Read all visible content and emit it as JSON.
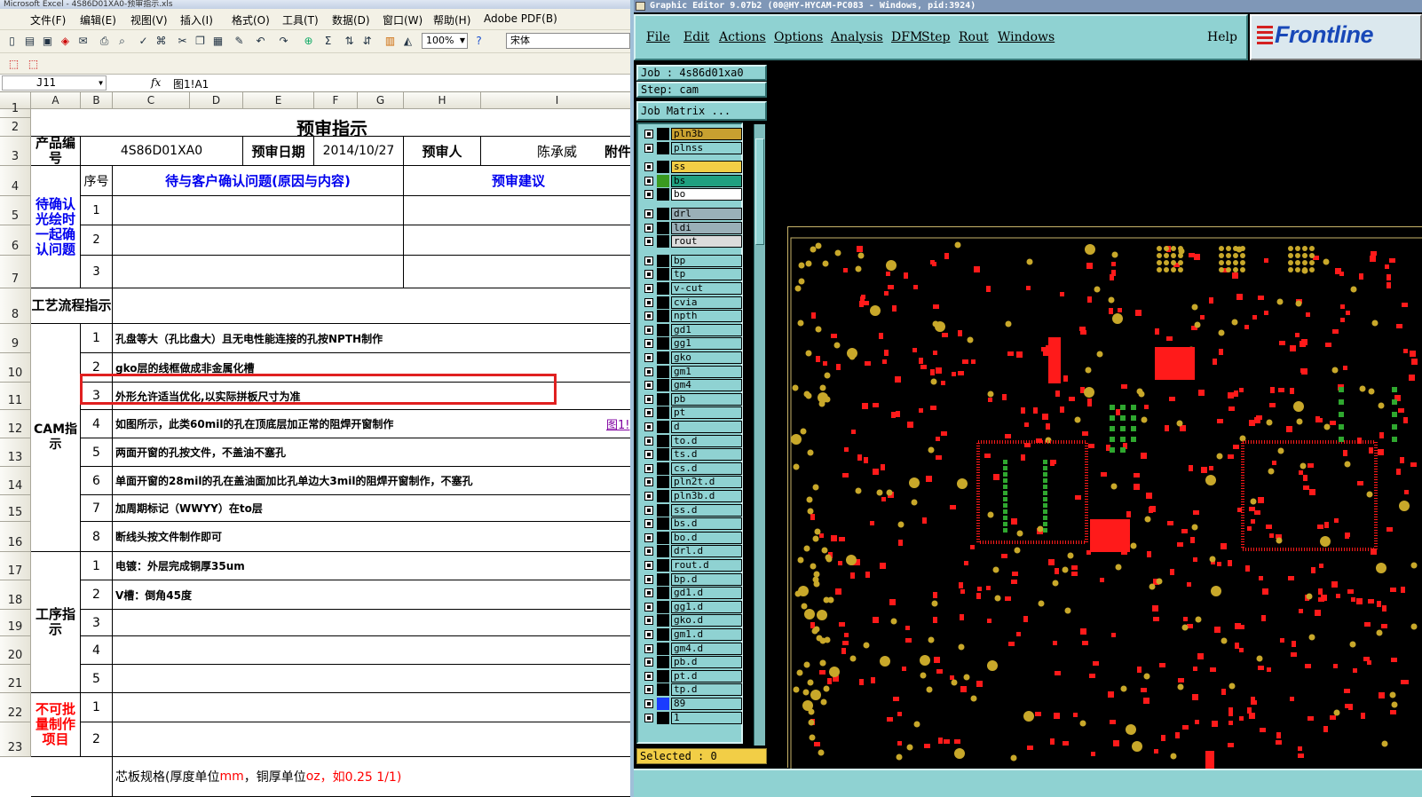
{
  "excel": {
    "title": "Microsoft Excel - 4S86D01XA0-预审指示.xls",
    "menu": [
      "文件(F)",
      "编辑(E)",
      "视图(V)",
      "插入(I)",
      "格式(O)",
      "工具(T)",
      "数据(D)",
      "窗口(W)",
      "帮助(H)",
      "Adobe PDF(B)"
    ],
    "zoom": "100%",
    "font_name": "宋体",
    "name_box": "J11",
    "fx": "fx",
    "formula": "图1!A1",
    "columns": [
      "A",
      "B",
      "C",
      "D",
      "E",
      "F",
      "G",
      "H",
      "I"
    ],
    "rows": [
      "1",
      "2",
      "3",
      "4",
      "5",
      "6",
      "7",
      "8",
      "9",
      "10",
      "11",
      "12",
      "13",
      "14",
      "15",
      "16",
      "17",
      "18",
      "19",
      "20",
      "21",
      "22",
      "23"
    ],
    "title_cell": "预审指示",
    "product_no_label": "产品编号",
    "product_no": "4S86D01XA0",
    "review_date_label": "预审日期",
    "review_date": "2014/10/27",
    "reviewer_label": "预审人",
    "reviewer": "陈承威",
    "attachment_label": "附件",
    "confirm_group": "待确认光绘时一起确认问题",
    "seq_label": "序号",
    "issue_header": "待与客户确认问题(原因与内容)",
    "suggest_header": "预审建议",
    "confirm_rows": [
      "1",
      "2",
      "3"
    ],
    "process_label": "工艺流程指示",
    "cam_label": "CAM指示",
    "cam_items": [
      {
        "no": "1",
        "text": "孔盘等大（孔比盘大）且无电性能连接的孔按NPTH制作"
      },
      {
        "no": "2",
        "text": "gko层的线框做成非金属化槽"
      },
      {
        "no": "3",
        "text": "外形允许适当优化,以实际拼板尺寸为准"
      },
      {
        "no": "4",
        "text": "如图所示，此类60mil的孔在顶底层加正常的阻焊开窗制作"
      },
      {
        "no": "5",
        "text": "两面开窗的孔按文件，不盖油不塞孔"
      },
      {
        "no": "6",
        "text": "单面开窗的28mil的孔在盖油面加比孔单边大3mil的阻焊开窗制作，不塞孔"
      },
      {
        "no": "7",
        "text": "加周期标记（WWYY）在to层"
      },
      {
        "no": "8",
        "text": "断线头按文件制作即可"
      }
    ],
    "link_text": "图1!",
    "process_step_label": "工序指示",
    "process_items": [
      {
        "no": "1",
        "text": "电镀：外层完成铜厚35um"
      },
      {
        "no": "2",
        "text": "V槽：倒角45度"
      },
      {
        "no": "3",
        "text": ""
      },
      {
        "no": "4",
        "text": ""
      },
      {
        "no": "5",
        "text": ""
      }
    ],
    "no_batch_label": "不可批量制作项目",
    "no_batch_rows": [
      "1",
      "2"
    ],
    "core_spec_a": "芯板规格(厚度单位",
    "core_spec_b": "mm",
    "core_spec_c": "，铜厚单位",
    "core_spec_d": "oz",
    "core_spec_e": "，如0.25 1/1)"
  },
  "frontline": {
    "title": "Graphic Editor 9.07b2 (00@HY-HYCAM-PC083 - Windows, pid:3924)",
    "menu": [
      "File",
      "Edit",
      "Actions",
      "Options",
      "Analysis",
      "DFM",
      "Step",
      "Rout",
      "Windows"
    ],
    "help": "Help",
    "logo": "Frontline",
    "job": "Job  : 4s86d01xa0",
    "step": "Step: cam",
    "job_matrix": "Job Matrix ...",
    "selected": "Selected : 0",
    "layers": [
      {
        "name": "pln3b",
        "fill": "#c8a030",
        "swatch": "#000"
      },
      {
        "name": "plnss",
        "fill": "#8fd2d2",
        "swatch": "#000"
      },
      {
        "name": "ss",
        "fill": "#f2ce46",
        "swatch": "#000"
      },
      {
        "name": "bs",
        "fill": "#20a080",
        "swatch": "#3a9a20"
      },
      {
        "name": "bo",
        "fill": "#ffffff",
        "swatch": "#000"
      },
      {
        "name": "drl",
        "fill": "#9ab0b8",
        "swatch": "#000"
      },
      {
        "name": "ldi",
        "fill": "#9ab0b8",
        "swatch": "#000"
      },
      {
        "name": "rout",
        "fill": "#dcdcdc",
        "swatch": "#000"
      },
      {
        "name": "bp",
        "fill": "#8fd2d2",
        "swatch": "#000"
      },
      {
        "name": "tp",
        "fill": "#8fd2d2",
        "swatch": "#000"
      },
      {
        "name": "v-cut",
        "fill": "#8fd2d2",
        "swatch": "#000"
      },
      {
        "name": "cvia",
        "fill": "#8fd2d2",
        "swatch": "#000"
      },
      {
        "name": "npth",
        "fill": "#8fd2d2",
        "swatch": "#000"
      },
      {
        "name": "gd1",
        "fill": "#8fd2d2",
        "swatch": "#000"
      },
      {
        "name": "gg1",
        "fill": "#8fd2d2",
        "swatch": "#000"
      },
      {
        "name": "gko",
        "fill": "#8fd2d2",
        "swatch": "#000"
      },
      {
        "name": "gm1",
        "fill": "#8fd2d2",
        "swatch": "#000"
      },
      {
        "name": "gm4",
        "fill": "#8fd2d2",
        "swatch": "#000"
      },
      {
        "name": "pb",
        "fill": "#8fd2d2",
        "swatch": "#000"
      },
      {
        "name": "pt",
        "fill": "#8fd2d2",
        "swatch": "#000"
      },
      {
        "name": "d",
        "fill": "#8fd2d2",
        "swatch": "#000"
      },
      {
        "name": "to.d",
        "fill": "#8fd2d2",
        "swatch": "#000"
      },
      {
        "name": "ts.d",
        "fill": "#8fd2d2",
        "swatch": "#000"
      },
      {
        "name": "cs.d",
        "fill": "#8fd2d2",
        "swatch": "#000"
      },
      {
        "name": "pln2t.d",
        "fill": "#8fd2d2",
        "swatch": "#000"
      },
      {
        "name": "pln3b.d",
        "fill": "#8fd2d2",
        "swatch": "#000"
      },
      {
        "name": "ss.d",
        "fill": "#8fd2d2",
        "swatch": "#000"
      },
      {
        "name": "bs.d",
        "fill": "#8fd2d2",
        "swatch": "#000"
      },
      {
        "name": "bo.d",
        "fill": "#8fd2d2",
        "swatch": "#000"
      },
      {
        "name": "drl.d",
        "fill": "#8fd2d2",
        "swatch": "#000"
      },
      {
        "name": "rout.d",
        "fill": "#8fd2d2",
        "swatch": "#000"
      },
      {
        "name": "bp.d",
        "fill": "#8fd2d2",
        "swatch": "#000"
      },
      {
        "name": "gd1.d",
        "fill": "#8fd2d2",
        "swatch": "#000"
      },
      {
        "name": "gg1.d",
        "fill": "#8fd2d2",
        "swatch": "#000"
      },
      {
        "name": "gko.d",
        "fill": "#8fd2d2",
        "swatch": "#000"
      },
      {
        "name": "gm1.d",
        "fill": "#8fd2d2",
        "swatch": "#000"
      },
      {
        "name": "gm4.d",
        "fill": "#8fd2d2",
        "swatch": "#000"
      },
      {
        "name": "pb.d",
        "fill": "#8fd2d2",
        "swatch": "#000"
      },
      {
        "name": "pt.d",
        "fill": "#8fd2d2",
        "swatch": "#000"
      },
      {
        "name": "tp.d",
        "fill": "#8fd2d2",
        "swatch": "#000"
      },
      {
        "name": "89",
        "fill": "#8fd2d2",
        "swatch": "#1a3cff"
      },
      {
        "name": "1",
        "fill": "#8fd2d2",
        "swatch": "#000"
      }
    ],
    "colors": {
      "pad_red": "#ff1a1a",
      "pad_gold": "#c8a82a",
      "pad_green": "#2fa82f",
      "outline": "#c8b46a"
    }
  }
}
